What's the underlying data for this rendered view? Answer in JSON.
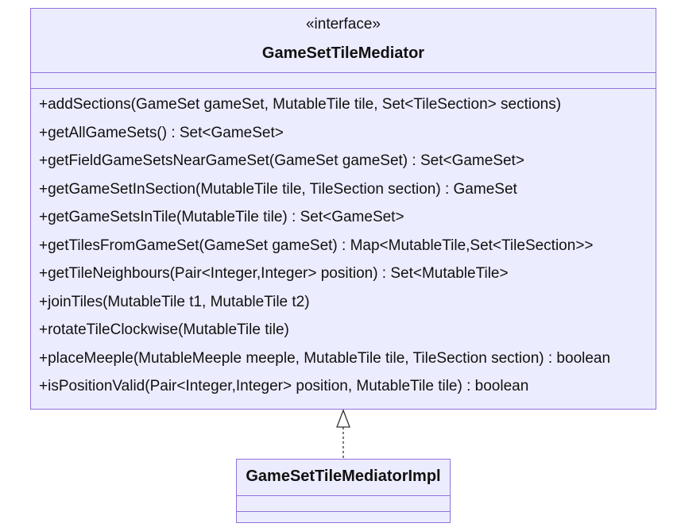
{
  "interface_box": {
    "stereotype": "«interface»",
    "name": "GameSetTileMediator",
    "attributes": [],
    "methods": [
      "+addSections(GameSet gameSet, MutableTile tile, Set<TileSection> sections)",
      "+getAllGameSets() : Set<GameSet>",
      "+getFieldGameSetsNearGameSet(GameSet gameSet) : Set<GameSet>",
      "+getGameSetInSection(MutableTile tile, TileSection section) : GameSet",
      "+getGameSetsInTile(MutableTile tile) : Set<GameSet>",
      "+getTilesFromGameSet(GameSet gameSet) : Map<MutableTile,Set<TileSection>>",
      "+getTileNeighbours(Pair<Integer,Integer> position) : Set<MutableTile>",
      "+joinTiles(MutableTile t1, MutableTile t2)",
      "+rotateTileClockwise(MutableTile tile)",
      "+placeMeeple(MutableMeeple meeple, MutableTile tile, TileSection section) : boolean",
      "+isPositionValid(Pair<Integer,Integer> position, MutableTile tile) : boolean"
    ]
  },
  "impl_box": {
    "name": "GameSetTileMediatorImpl",
    "attributes": [],
    "methods": []
  },
  "relation": {
    "type": "realization",
    "from": "GameSetTileMediatorImpl",
    "to": "GameSetTileMediator"
  },
  "colors": {
    "box_fill": "#ECECFF",
    "box_border": "#9370DB",
    "arrow_stroke": "#333333"
  }
}
